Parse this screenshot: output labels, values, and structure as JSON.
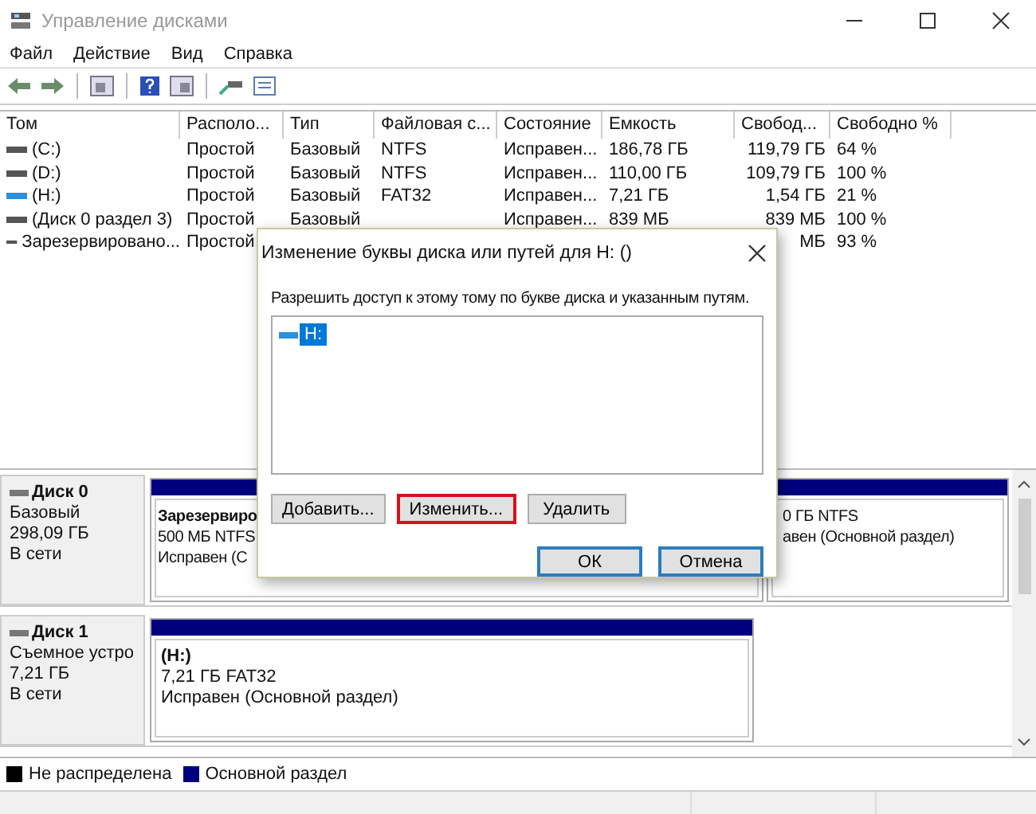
{
  "window": {
    "title": "Управление дисками"
  },
  "menu": [
    "Файл",
    "Действие",
    "Вид",
    "Справка"
  ],
  "table": {
    "columns": [
      "Том",
      "Располо...",
      "Тип",
      "Файловая с...",
      "Состояние",
      "Емкость",
      "Свобод...",
      "Свободно %"
    ],
    "rows": [
      {
        "kind": "fixed",
        "volume": "(C:)",
        "layout": "Простой",
        "type": "Базовый",
        "fs": "NTFS",
        "status": "Исправен...",
        "capacity": "186,78 ГБ",
        "free": "119,79 ГБ",
        "free_pct": "64 %"
      },
      {
        "kind": "fixed",
        "volume": "(D:)",
        "layout": "Простой",
        "type": "Базовый",
        "fs": "NTFS",
        "status": "Исправен...",
        "capacity": "110,00 ГБ",
        "free": "109,79 ГБ",
        "free_pct": "100 %"
      },
      {
        "kind": "removable",
        "volume": "(H:)",
        "layout": "Простой",
        "type": "Базовый",
        "fs": "FAT32",
        "status": "Исправен...",
        "capacity": "7,21 ГБ",
        "free": "1,54 ГБ",
        "free_pct": "21 %"
      },
      {
        "kind": "fixed",
        "volume": "(Диск 0 раздел 3)",
        "layout": "Простой",
        "type": "Базовый",
        "status": "Исправен...",
        "capacity": "839 МБ",
        "free": "839 МБ",
        "free_pct": "100 %"
      },
      {
        "kind": "fixed",
        "volume": "Зарезервировано...",
        "layout": "Простой",
        "free": "МБ",
        "free_pct": "93 %"
      }
    ]
  },
  "disks": [
    {
      "name": "Диск 0",
      "lines": [
        "Базовый",
        "298,09 ГБ",
        "В сети"
      ],
      "partitions": [
        {
          "kind": "primary",
          "title": "Зарезервиро",
          "lines": [
            "500 МБ NTFS",
            "Исправен (С"
          ]
        },
        {
          "kind": "primary",
          "lines": [
            "0 ГБ NTFS",
            "авен (Основной раздел)"
          ]
        }
      ]
    },
    {
      "name": "Диск 1",
      "lines": [
        "Съемное устро",
        "7,21 ГБ",
        "В сети"
      ],
      "partitions": [
        {
          "kind": "primary",
          "title": "(H:)",
          "lines": [
            "7,21 ГБ FAT32",
            "Исправен (Основной раздел)"
          ]
        }
      ]
    }
  ],
  "legend": [
    {
      "label": "Не распределена",
      "color": "#000000"
    },
    {
      "label": "Основной раздел",
      "color": "#00007f"
    }
  ],
  "dialog": {
    "title": "Изменение буквы диска или путей для H: ()",
    "prompt": "Разрешить доступ к этому тому по букве диска и указанным путям.",
    "paths": [
      {
        "label": "H:",
        "selected": true
      }
    ],
    "buttons": [
      {
        "label": "Добавить...",
        "kind": "action",
        "focused": false
      },
      {
        "label": "Изменить...",
        "kind": "action",
        "focused": true
      },
      {
        "label": "Удалить",
        "kind": "action",
        "focused": false
      },
      {
        "label": "ОК",
        "kind": "default",
        "focused": false
      },
      {
        "label": "Отмена",
        "kind": "default",
        "focused": false
      }
    ]
  }
}
